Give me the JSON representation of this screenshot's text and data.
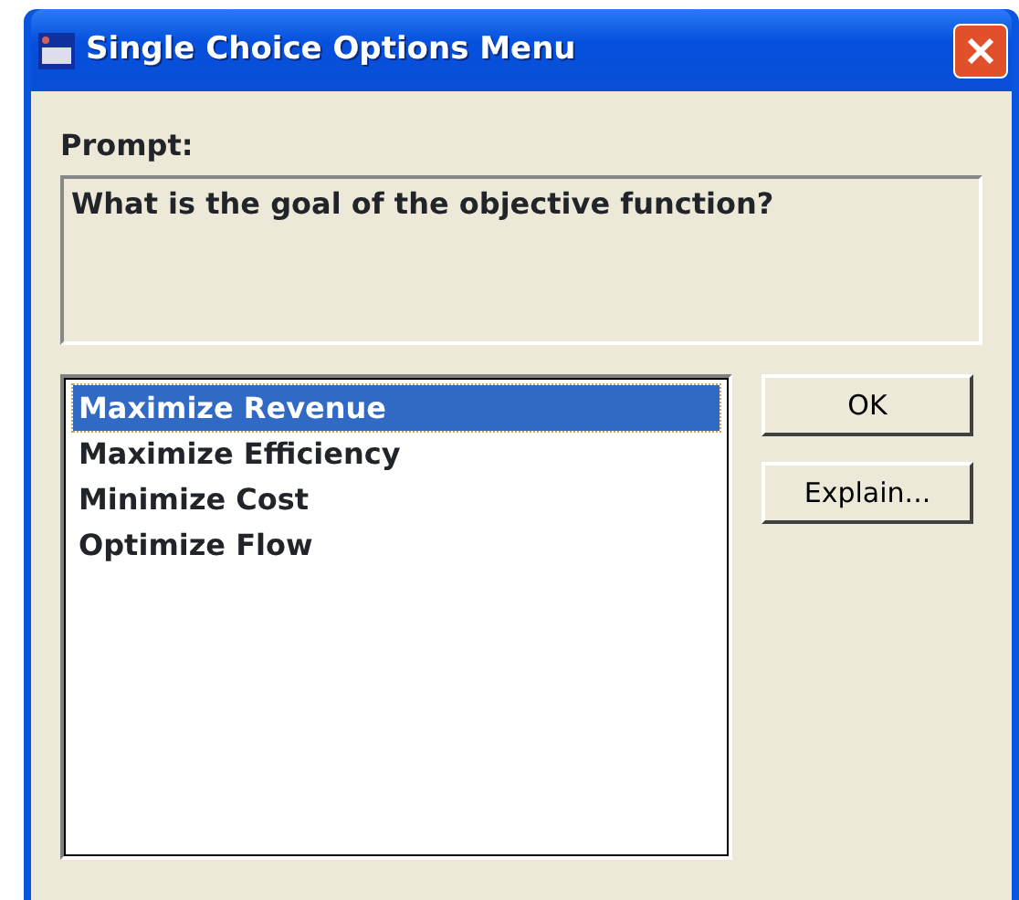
{
  "window": {
    "title": "Single Choice Options Menu"
  },
  "prompt": {
    "label": "Prompt:",
    "text": "What is the goal of the objective function?"
  },
  "options": [
    {
      "label": "Maximize Revenue",
      "selected": true
    },
    {
      "label": "Maximize Efficiency",
      "selected": false
    },
    {
      "label": "Minimize Cost",
      "selected": false
    },
    {
      "label": "Optimize Flow",
      "selected": false
    }
  ],
  "buttons": [
    "OK",
    "Explain..."
  ]
}
